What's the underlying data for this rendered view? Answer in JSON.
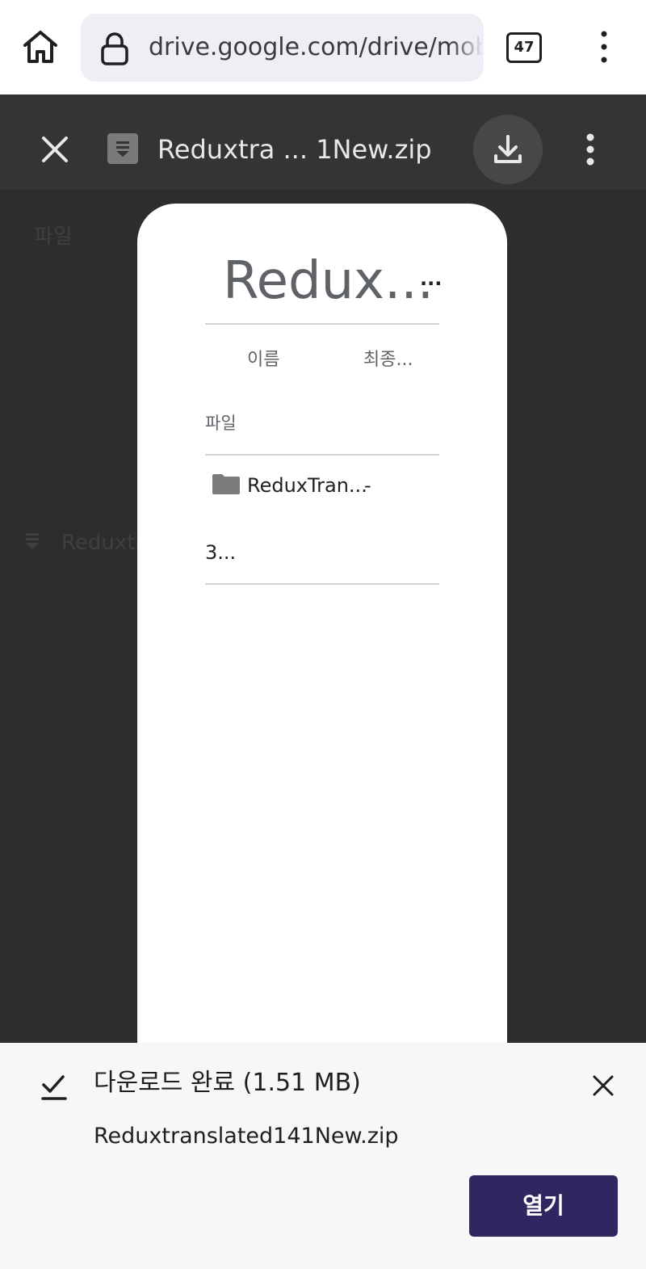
{
  "browser": {
    "url": "drive.google.com/drive/mobile",
    "tab_count": "47"
  },
  "viewer": {
    "file_title": "Reduxtra ... 1New.zip",
    "background_section_label": "파일",
    "background_row_name": "Reduxtra"
  },
  "preview": {
    "title": "Redux...",
    "title_more": "...",
    "columns": {
      "name": "이름",
      "modified": "최종..."
    },
    "section_label": "파일",
    "entries": [
      {
        "name": "ReduxTran...",
        "modified": "-",
        "size": "3...",
        "icon": "folder-icon"
      }
    ]
  },
  "download": {
    "status": "다운로드 완료 (1.51 MB)",
    "filename": "Reduxtranslated141New.zip",
    "open_label": "열기"
  },
  "colors": {
    "open_button": "#2f2760",
    "viewer_bg": "#2d2d2d",
    "sheet_bg": "#f7f7fa"
  }
}
